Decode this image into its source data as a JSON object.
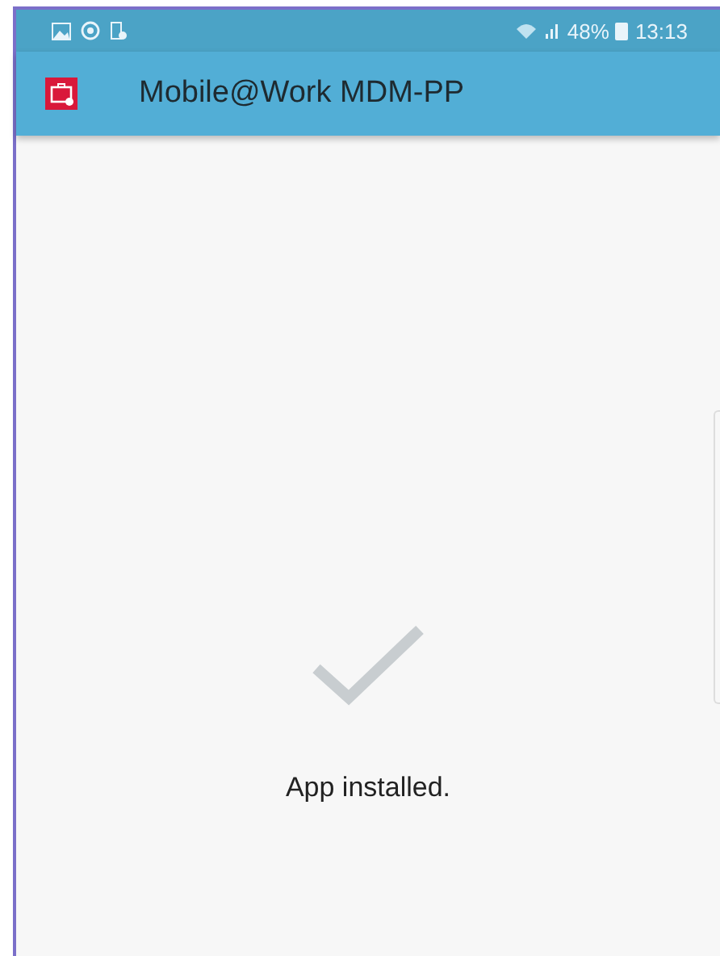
{
  "status_bar": {
    "battery": "48%",
    "time": "13:13"
  },
  "app_bar": {
    "title": "Mobile@Work MDM-PP"
  },
  "message": "App installed."
}
